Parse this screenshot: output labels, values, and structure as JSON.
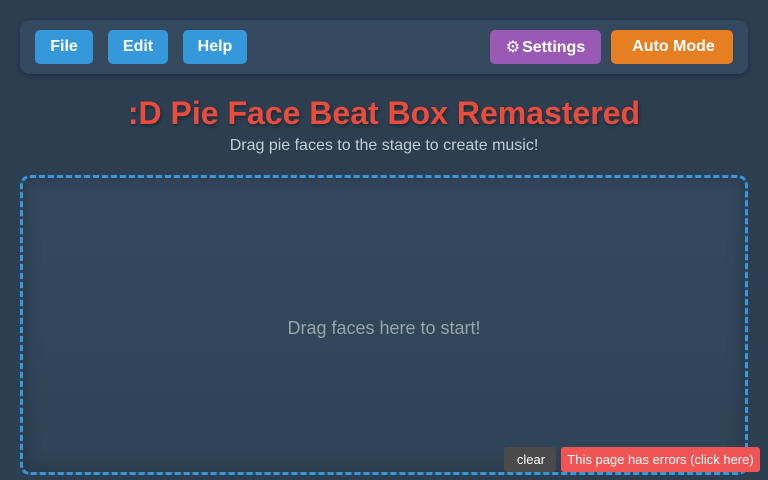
{
  "toolbar": {
    "file_label": "File",
    "edit_label": "Edit",
    "help_label": "Help",
    "settings_icon": "⚙",
    "settings_label": "Settings",
    "auto_icon": "",
    "auto_label": "Auto Mode"
  },
  "header": {
    "title": ":D Pie Face Beat Box Remastered",
    "subtitle": "Drag pie faces to the stage to create music!"
  },
  "stage": {
    "hint": "Drag faces here to start!"
  },
  "footer": {
    "clear_icon": "",
    "clear_label": "clear",
    "error_label": "This page has errors (click here)"
  },
  "colors": {
    "background": "#2c3e50",
    "panel": "#34495e",
    "primary_button": "#3498db",
    "settings_button": "#9b59b6",
    "auto_button": "#e67e22",
    "title": "#e74c3c",
    "stage_border": "#3498db",
    "error_badge": "#f05454"
  }
}
